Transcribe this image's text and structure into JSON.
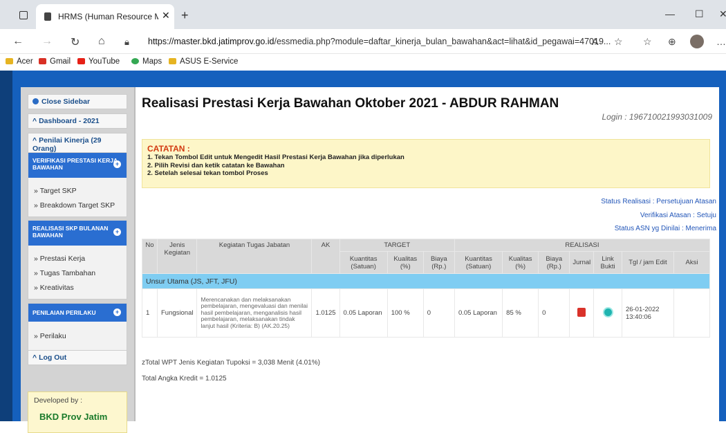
{
  "browser": {
    "tab_title": "HRMS (Human Resource Manag",
    "url_host": "https://master.bkd.jatimprov.go.id",
    "url_path": "/essmedia.php?module=daftar_kinerja_bulan_bawahan&act=lihat&id_pegawai=47019...",
    "bookmarks": [
      "Acer",
      "Gmail",
      "YouTube",
      "Maps",
      "ASUS E-Service"
    ]
  },
  "sidebar": {
    "close": "Close Sidebar",
    "dashboard": "Dashboard - 2021",
    "penilai": "Penilai Kinerja (29 Orang)",
    "box1_head": "VERIFIKASI PRESTASI KERJA BAWAHAN",
    "box1_items": [
      "» Target SKP",
      "» Breakdown Target SKP"
    ],
    "box2_head": "REALISASI SKP BULANAN BAWAHAN",
    "box2_items": [
      "» Prestasi Kerja",
      "» Tugas Tambahan",
      "» Kreativitas"
    ],
    "box3_head": "PENILAIAN PERILAKU",
    "box3_items": [
      "» Perilaku"
    ],
    "logout": "Log Out",
    "dev_label": "Developed by :",
    "dev_name": "BKD Prov Jatim"
  },
  "main": {
    "title": "Realisasi Prestasi Kerja Bawahan Oktober 2021 - ABDUR RAHMAN",
    "login": "Login : 196710021993031009",
    "catatan_head": "CATATAN :",
    "catatan_lines": [
      "1. Tekan Tombol Edit untuk Mengedit Hasil Prestasi Kerja Bawahan jika diperlukan",
      "2. Pilih Revisi dan ketik catatan ke Bawahan",
      "2. Setelah selesai tekan tombol Proses"
    ],
    "status_realisasi": "Status Realisasi : Persetujuan Atasan",
    "verifikasi": "Verifikasi Atasan : Setuju",
    "status_asn": "Status ASN yg Dinilai : Menerima",
    "headers": {
      "no": "No",
      "jenis": "Jenis Kegiatan",
      "kegiatan": "Kegiatan Tugas Jabatan",
      "ak": "AK",
      "target": "TARGET",
      "realisasi": "REALISASI",
      "kuantitas": "Kuantitas (Satuan)",
      "kualitas": "Kualitas (%)",
      "biaya": "Biaya (Rp.)",
      "jurnal": "Jurnal",
      "link": "Link Bukti",
      "tgl": "Tgl / jam Edit",
      "aksi": "Aksi"
    },
    "unsur": "Unsur Utama (JS, JFT, JFU)",
    "row": {
      "no": "1",
      "jenis": "Fungsional",
      "kegiatan": "Merencanakan dan melaksanakan pembelajaran, mengevaluasi dan menilai hasil pembelajaran, menganalisis hasil pembelajaran, melaksanakan tindak lanjut hasil (Kriteria: B) (AK.20.25)",
      "ak": "1.0125",
      "t_kuantitas": "0.05 Laporan",
      "t_kualitas": "100 %",
      "t_biaya": "0",
      "r_kuantitas": "0.05 Laporan",
      "r_kualitas": "85 %",
      "r_biaya": "0",
      "tgl": "26-01-2022 13:40:06"
    },
    "total_wpt": "zTotal WPT Jenis Kegiatan Tupoksi = 3,038 Menit (4.01%)",
    "total_ak": "Total Angka Kredit = 1.0125"
  }
}
